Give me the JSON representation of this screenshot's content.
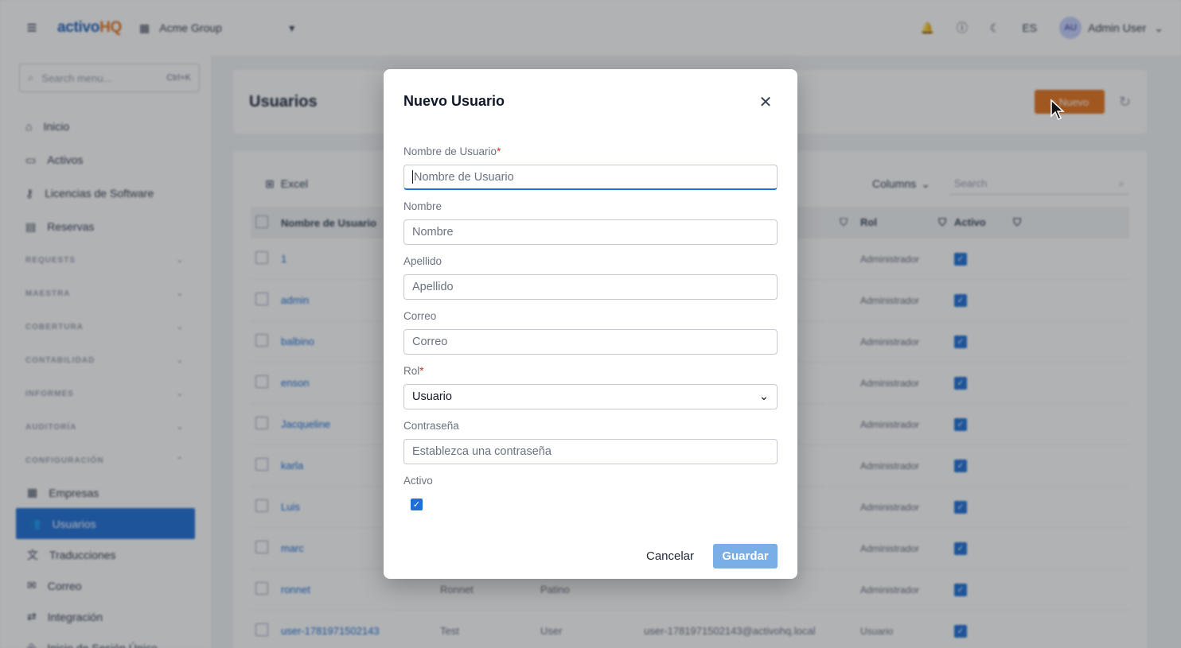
{
  "topbar": {
    "brand_part1": "activo",
    "brand_part2": "HQ",
    "org_name": "Acme Group",
    "lang": "ES",
    "avatar_initials": "AU",
    "user_name": "Admin User"
  },
  "sidebar": {
    "search_placeholder": "Search menu...",
    "search_shortcut": "Ctrl+K",
    "items": [
      {
        "label": "Inicio",
        "icon": "home-icon"
      },
      {
        "label": "Activos",
        "icon": "box-icon"
      },
      {
        "label": "Licencias de Software",
        "icon": "key-icon"
      },
      {
        "label": "Reservas",
        "icon": "calendar-icon"
      }
    ],
    "groups": [
      "REQUESTS",
      "MAESTRA",
      "COBERTURA",
      "CONTABILIDAD",
      "INFORMES",
      "AUDITORÍA",
      "CONFIGURACIÓN"
    ],
    "config_items": [
      {
        "label": "Empresas",
        "icon": "building-icon"
      },
      {
        "label": "Usuarios",
        "icon": "users-icon"
      },
      {
        "label": "Traducciones",
        "icon": "translate-icon"
      },
      {
        "label": "Correo",
        "icon": "mail-icon"
      },
      {
        "label": "Integración",
        "icon": "sync-icon"
      },
      {
        "label": "Inicio de Sesión Único",
        "icon": "login-icon"
      }
    ]
  },
  "page": {
    "title": "Usuarios",
    "new_button": "+ Nuevo"
  },
  "table": {
    "excel_label": "Excel",
    "columns_label": "Columns",
    "search_placeholder": "Search",
    "headers": {
      "user": "Nombre de Usuario",
      "role": "Rol",
      "active": "Activo"
    },
    "rows": [
      {
        "user": "1",
        "name": "",
        "last": "",
        "mail": "",
        "role": "Administrador"
      },
      {
        "user": "admin",
        "name": "",
        "last": "",
        "mail": "",
        "role": "Administrador"
      },
      {
        "user": "balbino",
        "name": "",
        "last": "",
        "mail": "",
        "role": "Administrador"
      },
      {
        "user": "enson",
        "name": "",
        "last": "",
        "mail": "",
        "role": "Administrador"
      },
      {
        "user": "Jacqueline",
        "name": "",
        "last": "",
        "mail": "",
        "role": "Administrador"
      },
      {
        "user": "karla",
        "name": "",
        "last": "",
        "mail": "",
        "role": "Administrador"
      },
      {
        "user": "Luis",
        "name": "",
        "last": "",
        "mail": "",
        "role": "Administrador"
      },
      {
        "user": "marc",
        "name": "",
        "last": "",
        "mail": "",
        "role": "Administrador"
      },
      {
        "user": "ronnet",
        "name": "Ronnet",
        "last": "Patino",
        "mail": "",
        "role": "Administrador"
      },
      {
        "user": "user-1781971502143",
        "name": "Test",
        "last": "User",
        "mail": "user-1781971502143@activohq.local",
        "role": "Usuario"
      }
    ]
  },
  "modal": {
    "title": "Nuevo Usuario",
    "username_label": "Nombre de Usuario",
    "username_placeholder": "Nombre de Usuario",
    "name_label": "Nombre",
    "name_placeholder": "Nombre",
    "lastname_label": "Apellido",
    "lastname_placeholder": "Apellido",
    "email_label": "Correo",
    "email_placeholder": "Correo",
    "role_label": "Rol",
    "role_value": "Usuario",
    "password_label": "Contraseña",
    "password_placeholder": "Establezca una contraseña",
    "active_label": "Activo",
    "active_checked": true,
    "cancel_label": "Cancelar",
    "save_label": "Guardar",
    "required_mark": "*"
  },
  "colors": {
    "primary": "#1f6fd6",
    "accent_orange": "#e8731c",
    "save_disabled": "#7aaee6",
    "required": "#dc2626"
  }
}
